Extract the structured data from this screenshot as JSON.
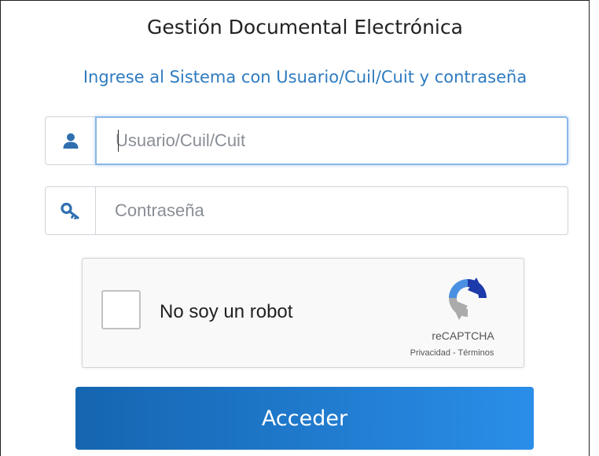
{
  "header": {
    "title": "Gestión Documental Electrónica",
    "subtitle": "Ingrese al Sistema con Usuario/Cuil/Cuit y contraseña"
  },
  "form": {
    "username": {
      "icon": "user-icon",
      "placeholder": "Usuario/Cuil/Cuit",
      "value": ""
    },
    "password": {
      "icon": "key-icon",
      "placeholder": "Contraseña",
      "value": ""
    },
    "recaptcha": {
      "label": "No soy un robot",
      "brand": "reCAPTCHA",
      "privacy": "Privacidad",
      "separator": " - ",
      "terms": "Términos",
      "checked": false
    },
    "submit_label": "Acceder"
  },
  "colors": {
    "subtitle": "#2e7bc0",
    "button_start": "#1565b0",
    "button_end": "#2a8ee8",
    "icon": "#2f6fb0"
  }
}
